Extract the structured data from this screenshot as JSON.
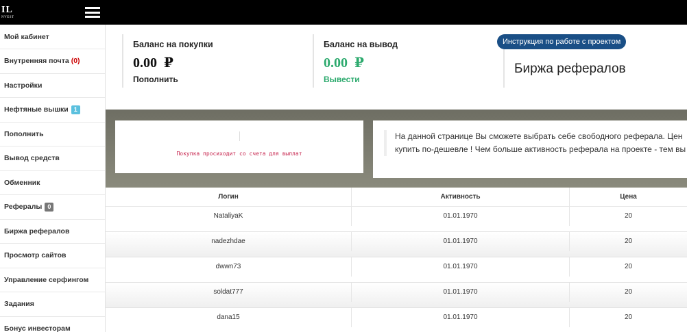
{
  "logo": {
    "big": "IL",
    "small": "NVEST"
  },
  "sidebar": {
    "items": [
      {
        "label": "Мой кабинет"
      },
      {
        "label": "Внутренняя почта",
        "count": "(0)"
      },
      {
        "label": "Настройки"
      },
      {
        "label": "Нефтяные вышки",
        "badge": "1",
        "badge_color": "#5bc0de"
      },
      {
        "label": "Пополнить"
      },
      {
        "label": "Вывод средств"
      },
      {
        "label": "Обменник"
      },
      {
        "label": "Рефералы",
        "badge": "0",
        "badge_color": "#777777"
      },
      {
        "label": "Биржа рефералов"
      },
      {
        "label": "Просмотр сайтов"
      },
      {
        "label": "Управление серфингом"
      },
      {
        "label": "Задания"
      },
      {
        "label": "Бонус инвесторам"
      }
    ]
  },
  "balances": {
    "purchase": {
      "label": "Баланс на покупки",
      "amount": "0.00",
      "currency": "₽",
      "action": "Пополнить"
    },
    "withdraw": {
      "label": "Баланс на вывод",
      "amount": "0.00",
      "currency": "₽",
      "action": "Вывести",
      "color": "#2daa6e"
    }
  },
  "instruction_button": "Инструкция по работе с проектом",
  "page_title": "Биржа рефералов",
  "note": "Покупка просиходит со счета для выплат",
  "info_text": {
    "line1": "На данной странице Вы сможете выбрать себе свободного реферала. Цен",
    "line2": "купить по-дешевле ! Чем больше активность реферала на проекте - тем вы"
  },
  "table": {
    "headers": [
      "Логин",
      "Активность",
      "Цена"
    ],
    "rows": [
      [
        "NataliyaK",
        "01.01.1970",
        "20"
      ],
      [
        "nadezhdae",
        "01.01.1970",
        "20"
      ],
      [
        "dwwn73",
        "01.01.1970",
        "20"
      ],
      [
        "soldat777",
        "01.01.1970",
        "20"
      ],
      [
        "dana15",
        "01.01.1970",
        "20"
      ]
    ]
  }
}
